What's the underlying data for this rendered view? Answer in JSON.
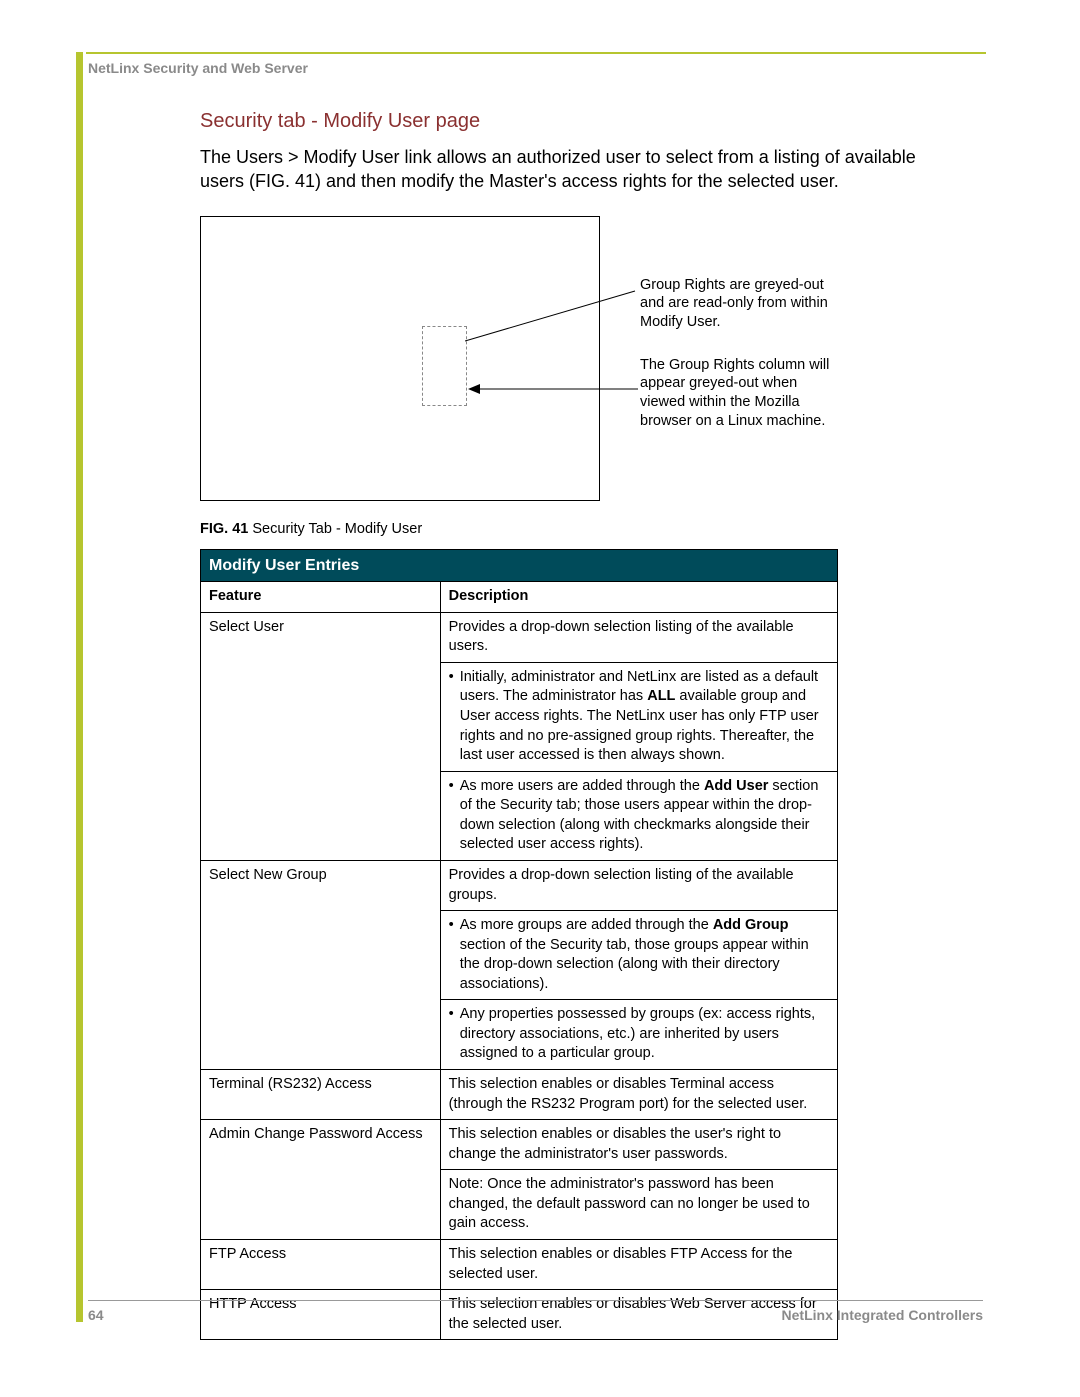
{
  "header": {
    "left": "NetLinx Security and Web Server"
  },
  "section": {
    "title": "Security tab - Modify User page",
    "paragraph": "The Users > Modify User link allows an authorized user to select from a listing of available users (FIG. 41) and then modify the Master's access rights for the selected user."
  },
  "figure": {
    "callout1": "Group Rights are greyed-out and are read-only from within Modify User.",
    "callout2": "The Group Rights column will appear greyed-out when viewed within the Mozilla browser on a Linux machine.",
    "caption_label": "FIG. 41",
    "caption_text": "Security Tab - Modify User"
  },
  "table": {
    "title": "Modify User Entries",
    "col1": "Feature",
    "col2": "Description",
    "rows": {
      "r1_feature": "Select User",
      "r1_desc": "Provides a drop-down selection listing of the available users.",
      "r1_b1_a": "Initially, administrator and NetLinx are listed as a default users. The administrator has ",
      "r1_b1_bold": "ALL",
      "r1_b1_b": " available group and User access rights. The NetLinx user has only FTP user rights and no pre-assigned group rights. Thereafter, the last user accessed is then always shown.",
      "r1_b2_a": "As more users are added through the ",
      "r1_b2_bold": "Add User",
      "r1_b2_b": " section of the Security tab; those users appear within the drop-down selection (along with checkmarks alongside their selected user access rights).",
      "r2_feature": "Select New Group",
      "r2_desc": "Provides a drop-down selection listing of the available groups.",
      "r2_b1_a": "As more groups are added through the ",
      "r2_b1_bold": "Add Group",
      "r2_b1_b": " section of the Security tab, those groups appear within the drop-down selection (along with their directory associations).",
      "r2_b2": "Any properties possessed by groups (ex: access rights, directory associations, etc.) are inherited by users assigned to a particular group.",
      "r3_feature": "Terminal (RS232) Access",
      "r3_desc": "This selection enables or disables Terminal access (through the RS232 Program port) for the selected user.",
      "r4_feature": "Admin Change Password Access",
      "r4_desc": "This selection enables or disables the user's right to change the administrator's user passwords.",
      "r4_note": "Note:  Once the administrator's password has been changed, the default password can no longer be used to gain access.",
      "r5_feature": "FTP Access",
      "r5_desc": "This selection enables or disables FTP Access for the selected user.",
      "r6_feature": "HTTP Access",
      "r6_desc": "This selection enables or disables Web Server access for the selected user."
    }
  },
  "footer": {
    "page": "64",
    "right": "NetLinx Integrated Controllers"
  }
}
